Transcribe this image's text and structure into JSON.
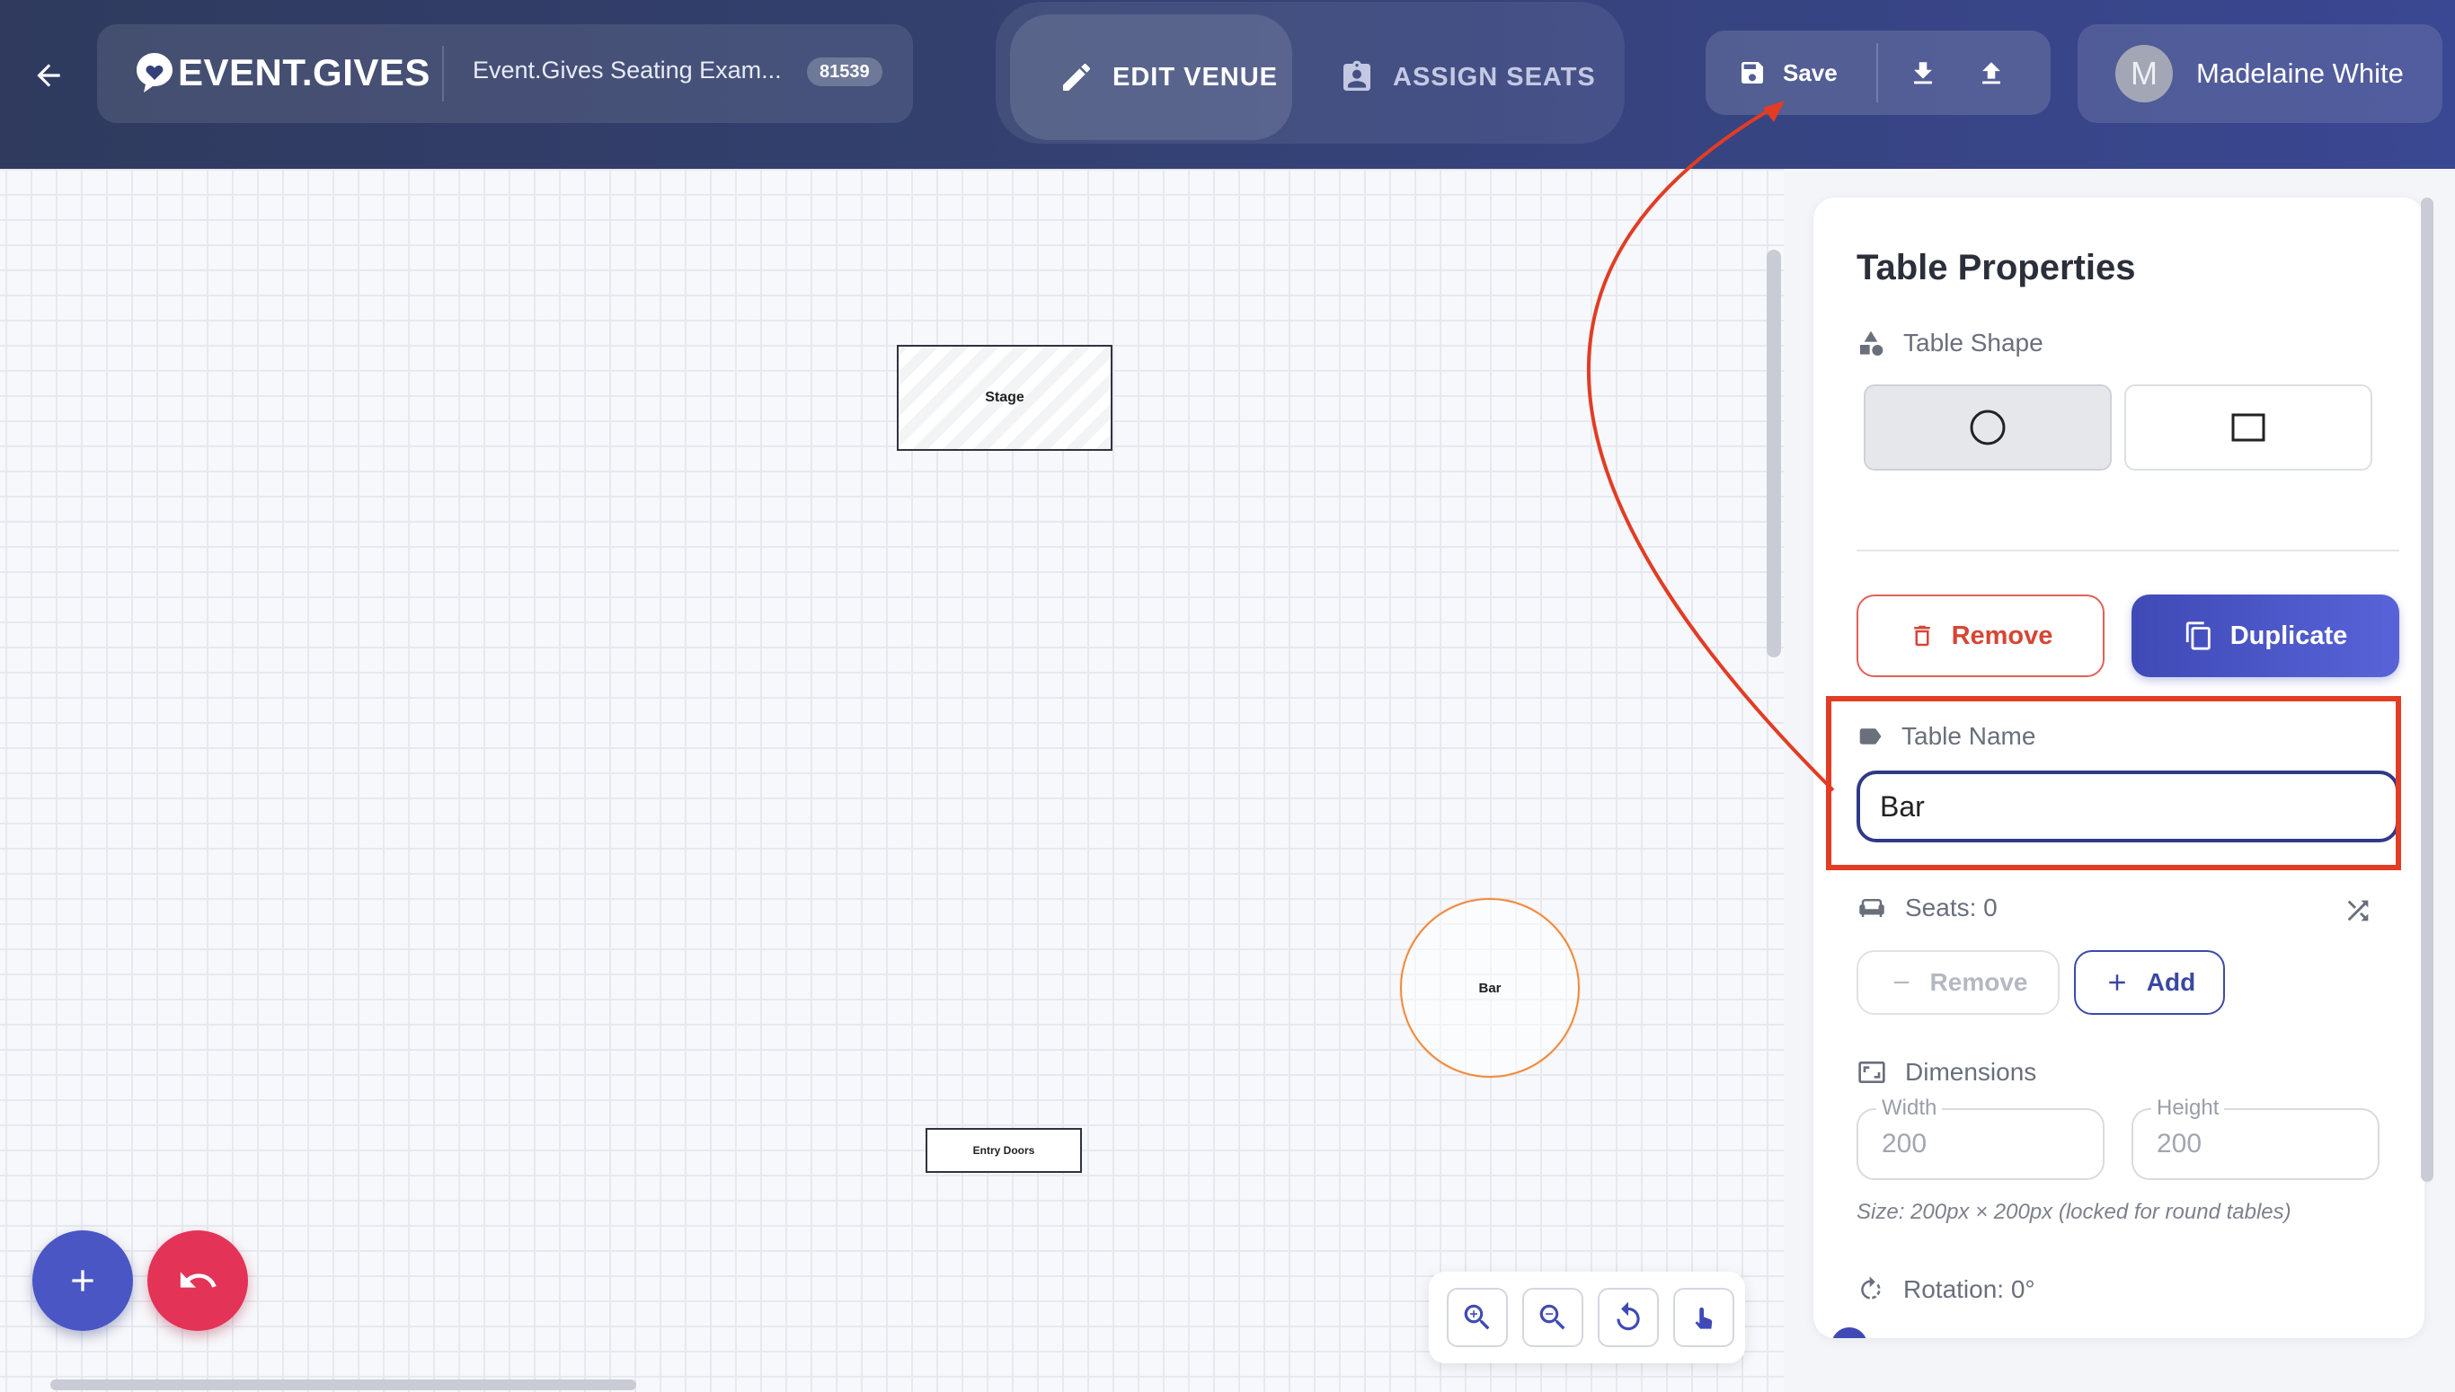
{
  "header": {
    "logo_text": "EVENT.GIVES",
    "event_name": "Event.Gives Seating Exam...",
    "event_id": "81539",
    "mode_edit_label": "EDIT VENUE",
    "mode_assign_label": "ASSIGN SEATS",
    "save_label": "Save",
    "user_initial": "M",
    "user_name": "Madelaine White"
  },
  "canvas": {
    "items": [
      {
        "label": "Stage",
        "shape": "rectangle"
      },
      {
        "label": "Bar",
        "shape": "round"
      },
      {
        "label": "Entry Doors",
        "shape": "rectangle"
      }
    ]
  },
  "panel": {
    "title": "Table Properties",
    "shape_label": "Table Shape",
    "shape_options": [
      "round",
      "rectangle"
    ],
    "selected_shape": "round",
    "remove_label": "Remove",
    "duplicate_label": "Duplicate",
    "name_label": "Table Name",
    "name_value": "Bar",
    "seats_label": "Seats: 0",
    "seat_remove_label": "Remove",
    "seat_add_label": "Add",
    "dimensions_label": "Dimensions",
    "width_label": "Width",
    "width_value": "200",
    "height_label": "Height",
    "height_value": "200",
    "dimensions_note": "Size: 200px × 200px (locked for round tables)",
    "rotation_label": "Rotation: 0°"
  },
  "colors": {
    "header": "#33406f",
    "accent": "#4a56c4",
    "danger": "#e33357",
    "highlight": "#e23c25",
    "bar_outline": "#f08a3c"
  }
}
